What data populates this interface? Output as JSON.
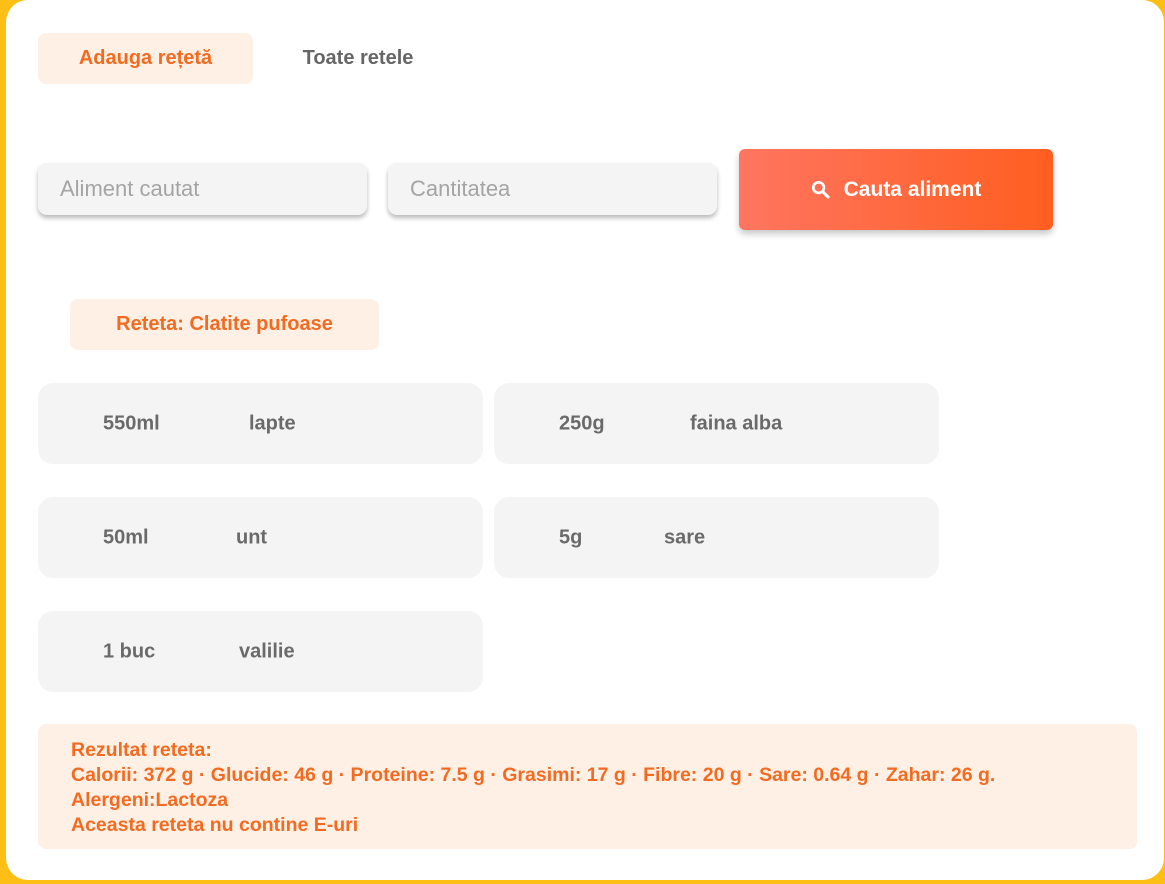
{
  "tabs": {
    "add_recipe": "Adauga rețetă",
    "all_recipes": "Toate retele"
  },
  "search": {
    "food_placeholder": "Aliment cautat",
    "quantity_placeholder": "Cantitatea",
    "button_label": "Cauta aliment",
    "icon": "search-icon"
  },
  "recipe": {
    "title": "Reteta: Clatite pufoase",
    "ingredients": [
      {
        "qty": "550ml",
        "name": "lapte"
      },
      {
        "qty": "250g",
        "name": "faina alba"
      },
      {
        "qty": "50ml",
        "name": "unt"
      },
      {
        "qty": "5g",
        "name": "sare"
      },
      {
        "qty": "1 buc",
        "name": "valilie"
      }
    ]
  },
  "result": {
    "heading": "Rezultat reteta:",
    "nutrition": "Calorii: 372 g · Glucide: 46 g · Proteine: 7.5 g · Grasimi: 17 g · Fibre: 20 g · Sare: 0.64 g · Zahar: 26 g.",
    "allergens": "Alergeni:Lactoza",
    "additives": "Aceasta reteta nu contine E-uri"
  },
  "colors": {
    "frame": "#FDBE16",
    "accent": "#F26B21",
    "accent_bg": "#FFF0E6",
    "button_start": "#FF7560",
    "button_end": "#FF5E1F",
    "card_bg": "#F4F4F4"
  }
}
